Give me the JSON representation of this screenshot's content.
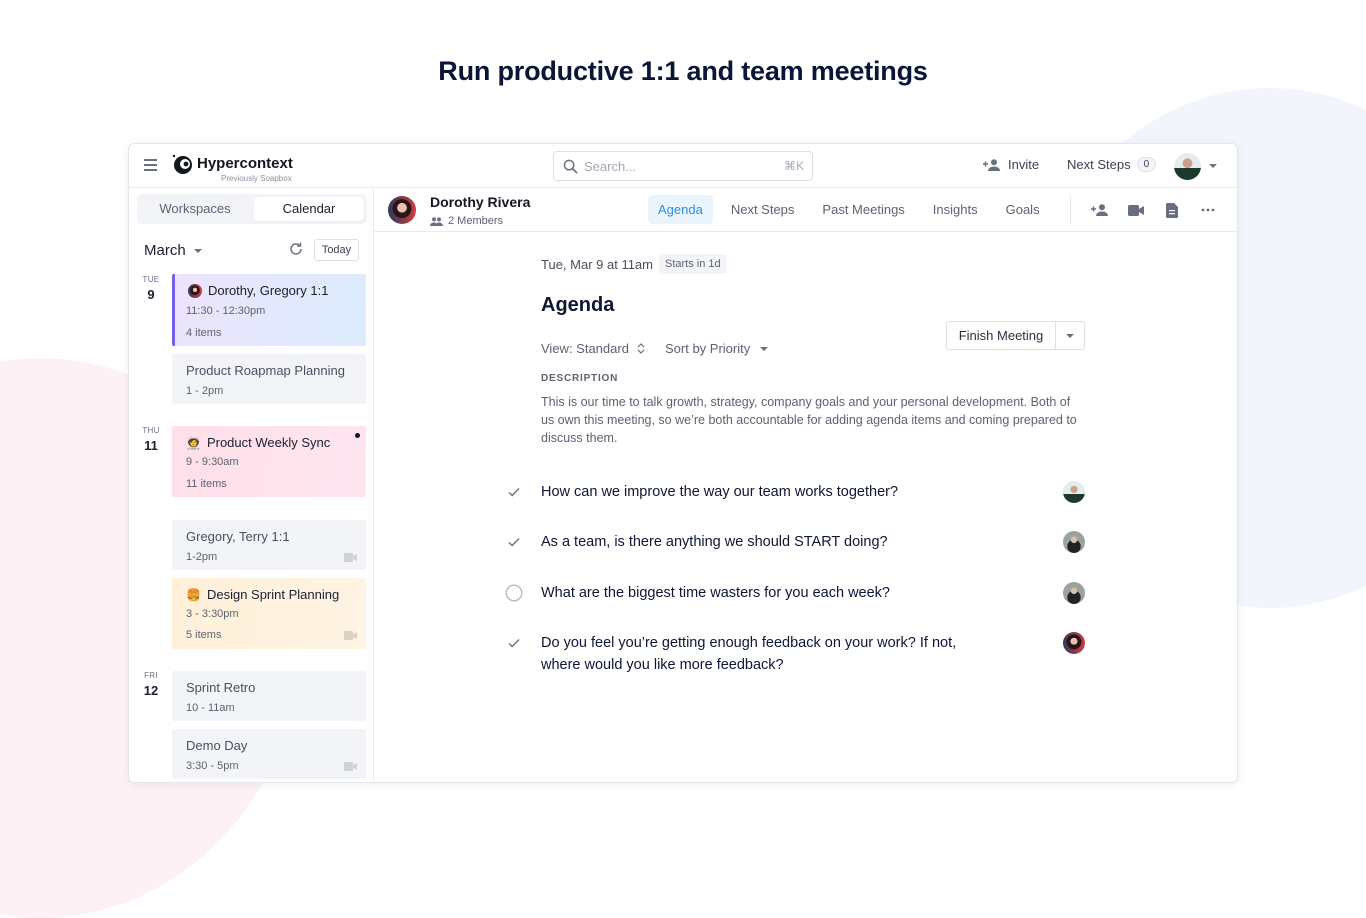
{
  "headline": "Run productive 1:1 and team meetings",
  "app": {
    "logo": {
      "name": "Hypercontext",
      "subtitle": "Previously Soapbox"
    },
    "search": {
      "placeholder": "Search...",
      "shortcut": "⌘K"
    },
    "topbar": {
      "invite_label": "Invite",
      "next_steps_label": "Next Steps",
      "next_steps_count": "0"
    },
    "icons": [
      "menu-icon",
      "search-icon",
      "add-person-icon",
      "chevron-down-icon",
      "refresh-icon",
      "video-camera-icon",
      "document-icon",
      "more-icon",
      "checkmark-icon",
      "circle-icon",
      "members-icon",
      "sort-updown-icon"
    ]
  },
  "sidebar": {
    "segments": [
      "Workspaces",
      "Calendar"
    ],
    "active_segment": "Calendar",
    "month": "March",
    "today_label": "Today",
    "days": [
      {
        "dow": "TUE",
        "num": "9"
      },
      {
        "dow": "THU",
        "num": "11"
      },
      {
        "dow": "FRI",
        "num": "12"
      }
    ],
    "events": [
      {
        "title": "Dorothy, Gregory 1:1",
        "time": "11:30 - 12:30pm",
        "items": "4 items",
        "style": "purple-gradient",
        "icon": "avatar"
      },
      {
        "title": "Product Roapmap Planning",
        "time": "1 - 2pm",
        "items": "",
        "style": "grey"
      },
      {
        "title": "Product Weekly Sync",
        "time": "9 - 9:30am",
        "items": "11 items",
        "style": "pink",
        "icon": "🧑‍🚀",
        "unread": true
      },
      {
        "title": "Gregory, Terry 1:1",
        "time": "1-2pm",
        "items": "",
        "style": "grey",
        "video": true
      },
      {
        "title": "Design Sprint Planning",
        "time": "3 - 3:30pm",
        "items": "5 items",
        "style": "yellow",
        "icon": "🍔",
        "video": true
      },
      {
        "title": "Sprint Retro",
        "time": "10 - 11am",
        "items": "",
        "style": "grey"
      },
      {
        "title": "Demo Day",
        "time": "3:30 - 5pm",
        "items": "",
        "style": "grey",
        "video": true
      }
    ]
  },
  "main": {
    "header": {
      "name": "Dorothy Rivera",
      "members": "2 Members"
    },
    "tabs": [
      {
        "label": "Agenda",
        "active": true
      },
      {
        "label": "Next Steps",
        "active": false
      },
      {
        "label": "Past Meetings",
        "active": false
      },
      {
        "label": "Insights",
        "active": false
      },
      {
        "label": "Goals",
        "active": false
      }
    ],
    "meeting_date": "Tue, Mar 9 at 11am",
    "starts_badge": "Starts in 1d",
    "title": "Agenda",
    "view_label": "View: Standard",
    "sort_label": "Sort by Priority",
    "finish_label": "Finish Meeting",
    "description_label": "DESCRIPTION",
    "description": "This is our time to talk growth, strategy, company goals and your personal development. Both of us own this meeting, so we’re both accountable for adding agenda items and coming prepared to discuss them.",
    "agenda_items": [
      {
        "text": "How can we improve the way our team works together?",
        "done": true,
        "owner": "a"
      },
      {
        "text": "As a team, is there anything we should START doing?",
        "done": true,
        "owner": "b"
      },
      {
        "text": "What are the biggest time wasters for you each week?",
        "done": false,
        "owner": "b"
      },
      {
        "text": "Do you feel you’re getting enough feedback on your work? If not, where would you like more feedback?",
        "done": true,
        "owner": "c"
      }
    ]
  },
  "colors": {
    "accent": "#2f8ee0",
    "tab_active_bg": "#eaf4fd",
    "text_dark": "#0f1535",
    "text_muted": "#5d6273",
    "event_purple_border": "#7b5cf0",
    "event_pink": "#fde0ea",
    "event_yellow": "#fff1d6"
  }
}
